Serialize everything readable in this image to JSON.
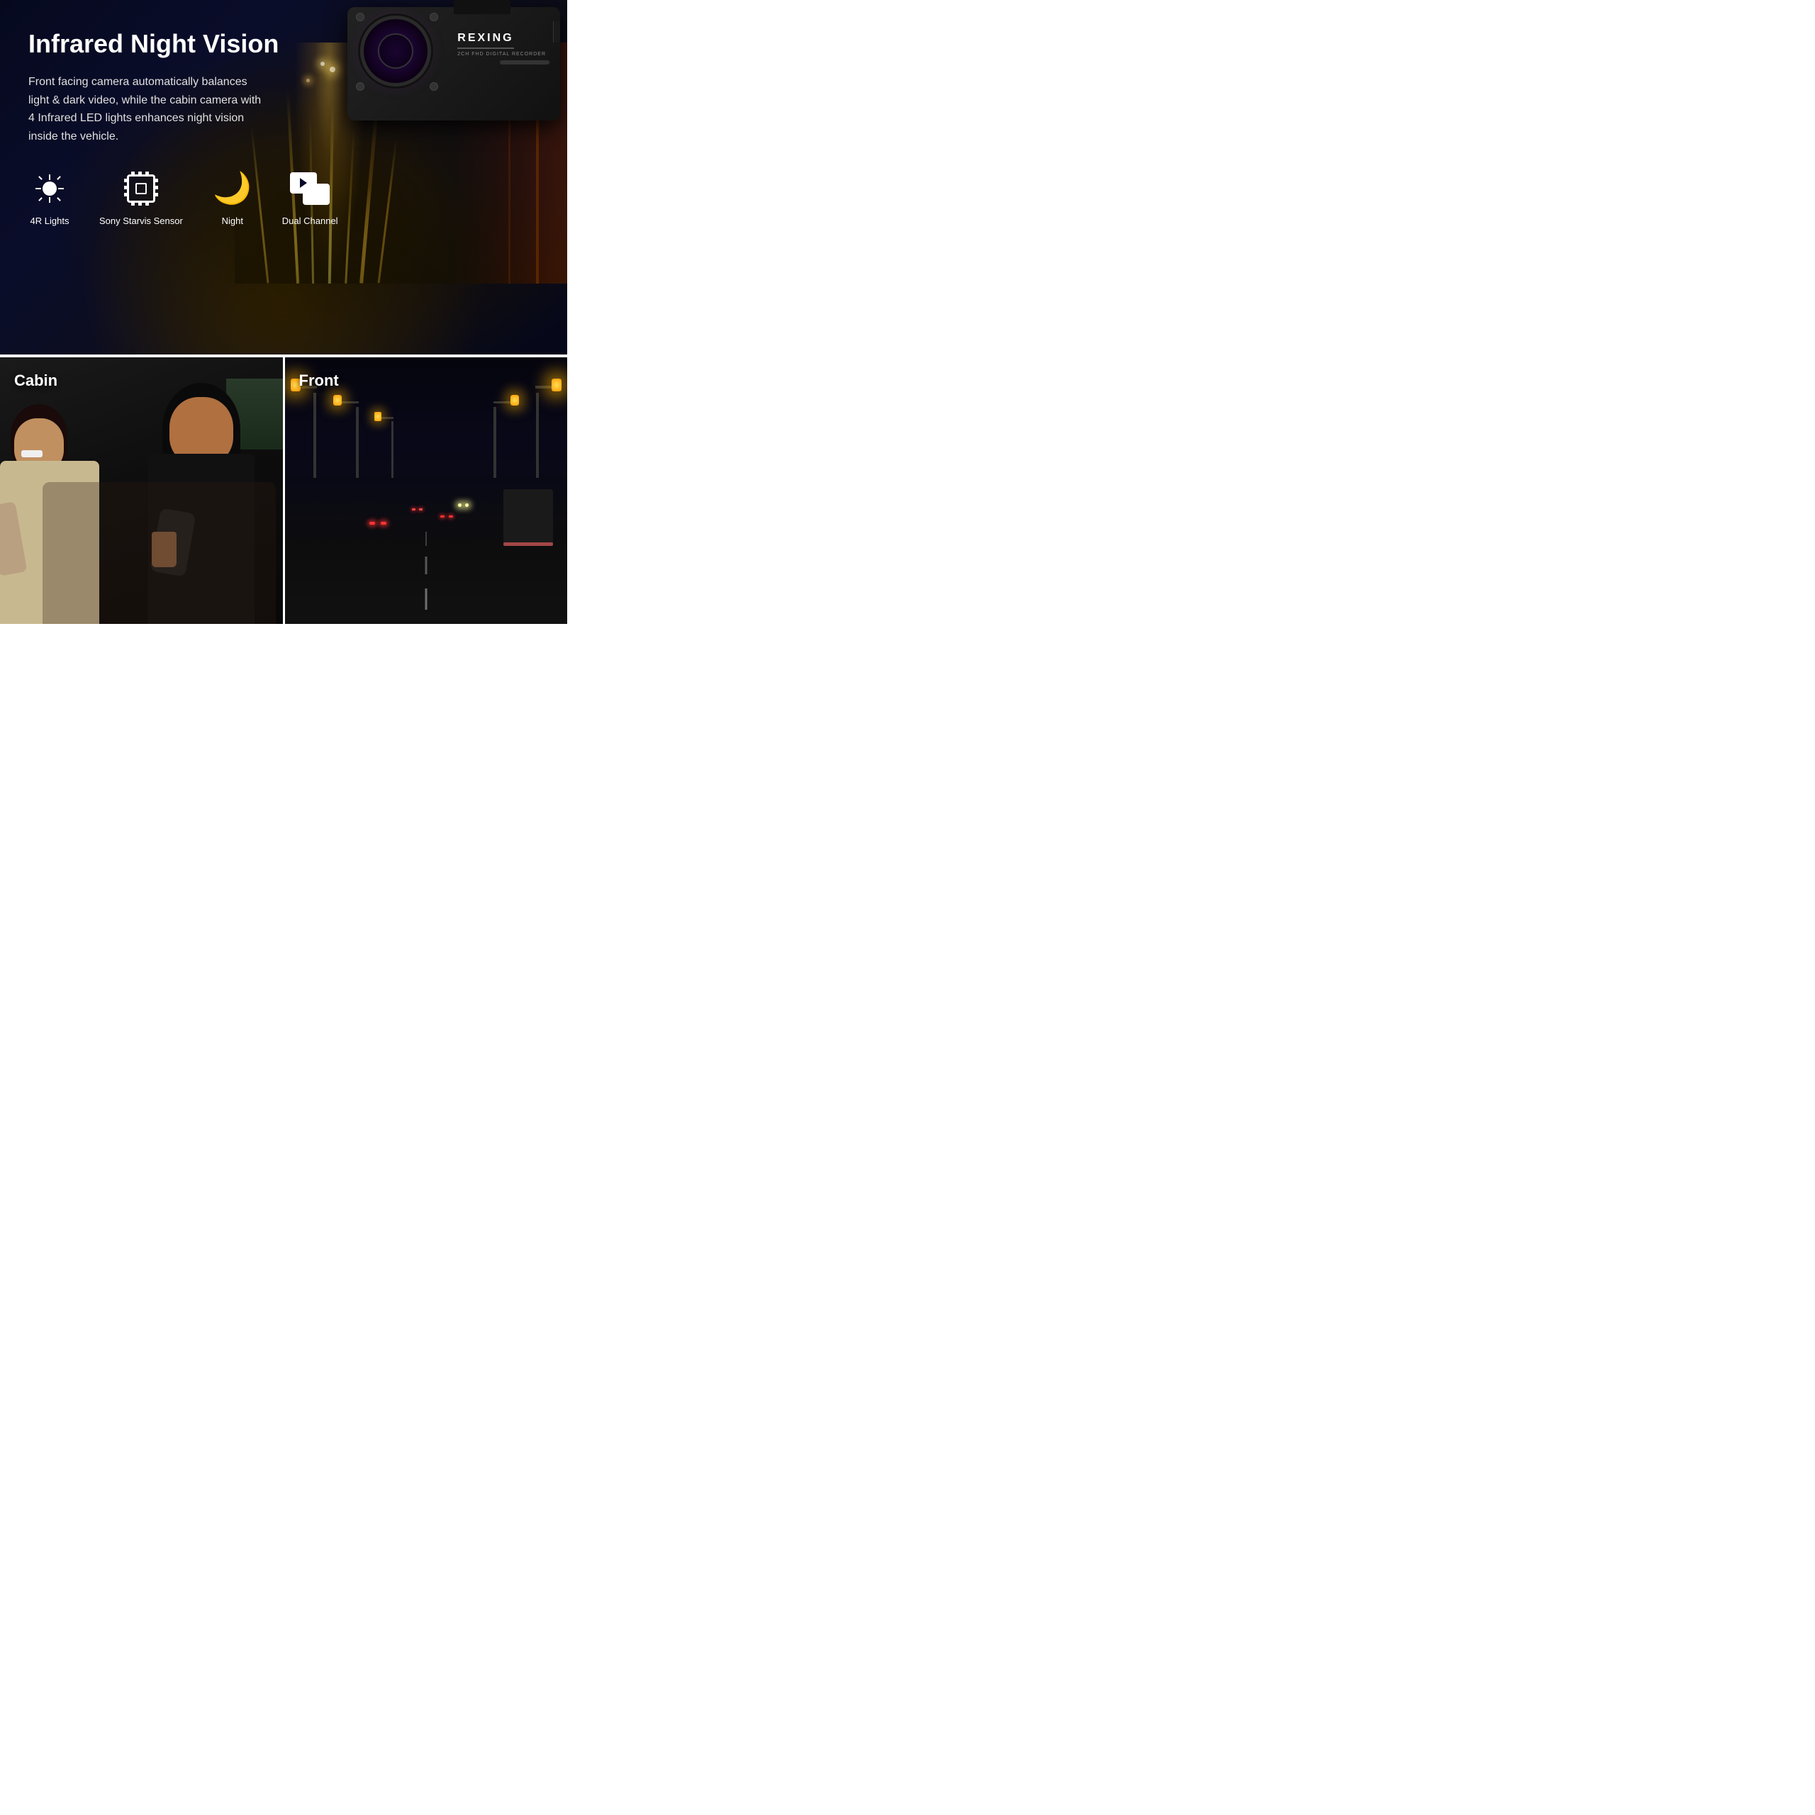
{
  "top": {
    "title": "Infrared Night Vision",
    "description": "Front facing camera automatically balances light & dark video, while the cabin camera with 4 Infrared LED lights enhances night vision inside the vehicle.",
    "brand": "REXING",
    "brand_sub": "2CH FHD DIGITAL RECORDER",
    "features": [
      {
        "id": "4r-lights",
        "label": "4R Lights",
        "icon": "sun"
      },
      {
        "id": "sony-starvis",
        "label": "Sony Starvis Sensor",
        "icon": "chip"
      },
      {
        "id": "night",
        "label": "Night",
        "icon": "moon"
      },
      {
        "id": "dual-channel",
        "label": "Dual Channel",
        "icon": "dual"
      }
    ]
  },
  "bottom": {
    "cabin": {
      "label": "Cabin"
    },
    "front": {
      "label": "Front"
    }
  },
  "colors": {
    "bg_dark": "#05071a",
    "text_white": "#ffffff",
    "accent": "#ffcc44"
  }
}
